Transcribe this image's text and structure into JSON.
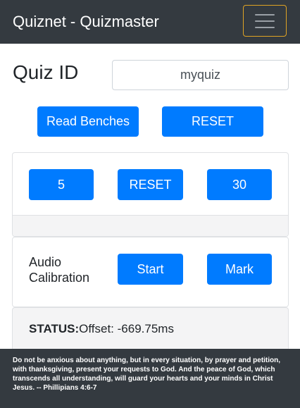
{
  "navbar": {
    "brand": "Quiznet - Quizmaster",
    "menu_icon": "hamburger-menu-icon"
  },
  "quiz": {
    "label": "Quiz ID",
    "value": "myquiz"
  },
  "actions": {
    "read_benches": "Read Benches",
    "reset": "RESET"
  },
  "timer": {
    "short_label": "5",
    "reset_label": "RESET",
    "long_label": "30"
  },
  "audio": {
    "label": "Audio Calibration",
    "start_label": "Start",
    "mark_label": "Mark"
  },
  "status": {
    "label": "STATUS:",
    "text": "Offset: -669.75ms"
  },
  "footer": {
    "verse": "Do not be anxious about anything, but in every situation, by prayer and petition, with thanksgiving, present your requests to God. And the peace of God, which transcends all understanding, will guard your hearts and your minds in Christ Jesus. -- Phillipians 4:6-7"
  },
  "colors": {
    "primary": "#007bff",
    "navbar": "#343a40",
    "toggler_border": "#e0a424"
  }
}
